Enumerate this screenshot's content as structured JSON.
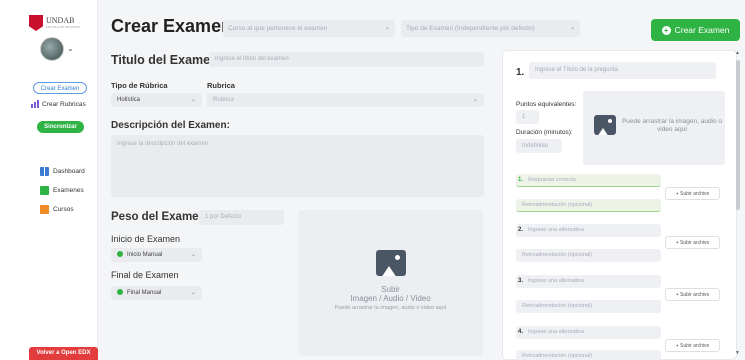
{
  "sidebar": {
    "logo_text": "UNDAB",
    "logo_sub": "ESCUELA DE NEGOCIOS",
    "crear_examen": "Crear Examen",
    "crear_rubricas": "Crear Rubricas",
    "sincronizar": "Sincronizar",
    "nav": [
      {
        "label": "Dashboard",
        "icon": "dashboard-icon"
      },
      {
        "label": "Examenes",
        "icon": "document-icon"
      },
      {
        "label": "Cursos",
        "icon": "courses-icon"
      }
    ],
    "open_edx": "Volver a Open EDX"
  },
  "header": {
    "title": "Crear Examen",
    "course_placeholder": "Curso al que pertenece el examen",
    "type_placeholder": "Tipo de Examen (Independiente por defecto)",
    "crear_button": "Crear Examen"
  },
  "form": {
    "titulo_label": "Titulo del Examen:",
    "titulo_placeholder": "Ingrese el título del examen",
    "tipo_rubrica_label": "Tipo de Rúbrica",
    "tipo_rubrica_value": "Holística",
    "rubrica_label": "Rubrica",
    "rubrica_value": "Rubrica",
    "descripcion_label": "Descripción del Examen:",
    "descripcion_placeholder": "Ingrese la descripción del examen",
    "peso_label": "Peso del Examen:",
    "peso_placeholder": "1 por Defecto",
    "inicio_label": "Inicio de Examen",
    "inicio_value": "Inicio Manual",
    "final_label": "Final de Examen",
    "final_value": "Final Manual",
    "upload_title": "Subir",
    "upload_types": "Imagen / Audio / Video",
    "upload_hint": "Puede arrastrar la imagen, audio o video aquí"
  },
  "question": {
    "number": "1.",
    "title_placeholder": "Ingrese el Título de la pregunta",
    "puntos_label": "Puntos equivalentes:",
    "puntos_value": "1",
    "duracion_label": "Duración (minutos):",
    "duracion_value": "Indefinido",
    "media_hint": "Puede arrastrar la imagen, audio o video aquí",
    "subir_archivo": "+ Subir archivo",
    "feedback_placeholder": "Retroalimentación (opcional)",
    "alternatives": [
      {
        "num": "1.",
        "placeholder": "Respuesta correcta",
        "correct": true
      },
      {
        "num": "2.",
        "placeholder": "Ingrese una alternativa",
        "correct": false
      },
      {
        "num": "3.",
        "placeholder": "Ingrese una alternativa",
        "correct": false
      },
      {
        "num": "4.",
        "placeholder": "Ingrese una alternativa",
        "correct": false
      }
    ]
  },
  "colors": {
    "green": "#2fb344",
    "red": "#e23c3c",
    "blue": "#3b7bd0"
  }
}
